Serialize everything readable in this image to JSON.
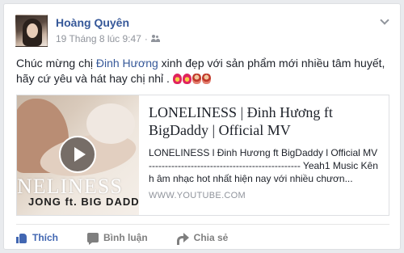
{
  "post": {
    "author": "Hoàng Quyên",
    "timestamp": "19 Tháng 8 lúc 9:47",
    "separator": "·",
    "audience_icon": "friends-icon",
    "text_before": "Chúc mừng chị ",
    "mention": "Đinh Hương",
    "text_after": " xinh đẹp với sản phẩm mới nhiều tâm huyết, hãy cứ yêu và hát hay chị nhỉ .",
    "emojis": [
      "heart-icon",
      "heart-icon",
      "girl-icon",
      "girl-icon"
    ]
  },
  "link_card": {
    "thumb_title": "NELINESS",
    "thumb_subtitle": "JONG ft. BIG DADDY",
    "title": "LONELINESS | Đinh Hương ft BigDaddy | Official MV",
    "description": "LONELINESS l Đinh Hương ft BigDaddy l Official MV ----------------------------------------------- Yeah1 Music Kênh âm nhạc hot nhất hiện nay với nhiều chươn...",
    "domain": "WWW.YOUTUBE.COM"
  },
  "actions": {
    "like": "Thích",
    "comment": "Bình luận",
    "share": "Chia sẻ"
  },
  "colors": {
    "link_blue": "#365899",
    "like_blue": "#4267b2",
    "meta_gray": "#90949c"
  }
}
